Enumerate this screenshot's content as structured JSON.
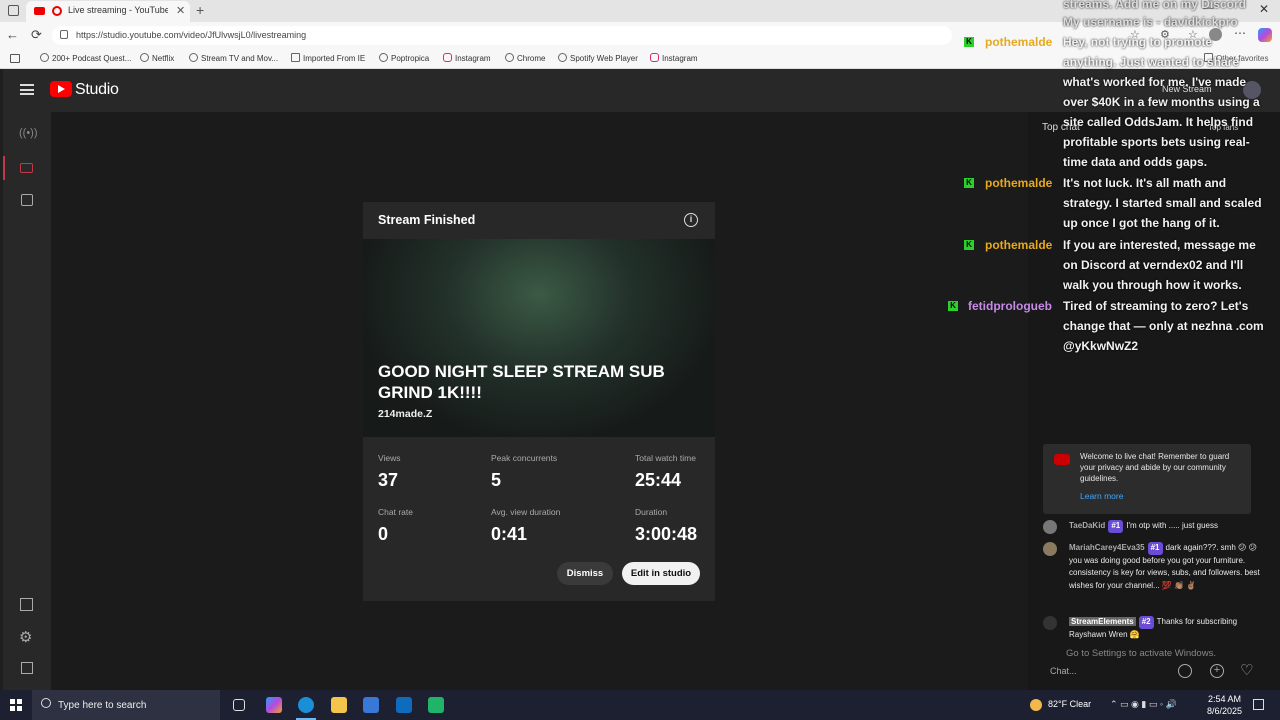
{
  "browser": {
    "tab_title": "Live streaming - YouTube Stu",
    "url": "https://studio.youtube.com/video/JfUlvwsjL0/livestreaming",
    "bookmarks": [
      "200+ Podcast Quest...",
      "Netflix",
      "Stream TV and Mov...",
      "Imported From IE",
      "Poptropica",
      "Instagram",
      "Chrome",
      "Spotify Web Player",
      "Instagram"
    ],
    "other_favorites": "Other favorites"
  },
  "studio": {
    "logo": "Studio",
    "new_stream": "New Stream"
  },
  "modal": {
    "title": "Stream Finished",
    "stream_title_line1": "GOOD NIGHT SLEEP STREAM SUB",
    "stream_title_line2": "GRIND 1K!!!!",
    "channel": "214made.Z",
    "stats": {
      "views_label": "Views",
      "views": "37",
      "peak_label": "Peak concurrents",
      "peak": "5",
      "watch_label": "Total watch time",
      "watch": "25:44",
      "chatrate_label": "Chat rate",
      "chatrate": "0",
      "avgview_label": "Avg. view duration",
      "avgview": "0:41",
      "duration_label": "Duration",
      "duration": "3:00:48"
    },
    "dismiss": "Dismiss",
    "edit": "Edit in studio"
  },
  "overlay_chat": {
    "top_lines": [
      "streams. Add me on my Discord",
      "My username is - davidkickpro"
    ],
    "msg1_name": "pothemalde",
    "msg1_lines": [
      "Hey, not trying to promote",
      "anything. Just wanted to share",
      "what's worked for me. I've made",
      "over $40K in a few months using a",
      "site called OddsJam. It helps find",
      "profitable sports bets using real-",
      "time data and odds gaps."
    ],
    "msg2_name": "pothemalde",
    "msg2_lines": [
      "It's not luck. It's all math and",
      "strategy. I started small and scaled",
      "up once I got the hang of it."
    ],
    "msg3_name": "pothemalde",
    "msg3_lines": [
      "If you are interested, message me",
      "on Discord at verndex02 and I'll",
      "walk you through how it works."
    ],
    "msg4_name": "fetidprologueb",
    "msg4_lines": [
      "Tired of streaming to zero? Let's",
      "change that — only at nezhna .com",
      "@yKkwNwZ2"
    ]
  },
  "chat": {
    "top_chat": "Top chat",
    "top_fans": "Top fans",
    "welcome": "Welcome to live chat! Remember to guard your privacy and abide by our community guidelines.",
    "learn_more": "Learn more",
    "messages": [
      {
        "name": "TaeDaKid",
        "badge": "#1",
        "text": "I'm otp with ..... just guess"
      },
      {
        "name": "MariahCarey4Eva35",
        "badge": "#1",
        "text": "dark again???. smh 😕 😕 you was doing good before you got your furniture. consistency is key for views, subs, and followers. best wishes for your channel... 💯 👏🏽 ✌🏽"
      },
      {
        "name": "StreamElements",
        "badge": "#2",
        "text": "Thanks for subscribing Rayshawn Wren 🤗"
      }
    ],
    "activate": "Go to Settings to activate Windows.",
    "input_placeholder": "Chat..."
  },
  "taskbar": {
    "search": "Type here to search",
    "weather": "82°F  Clear",
    "time": "2:54 AM",
    "date": "8/6/2025"
  }
}
